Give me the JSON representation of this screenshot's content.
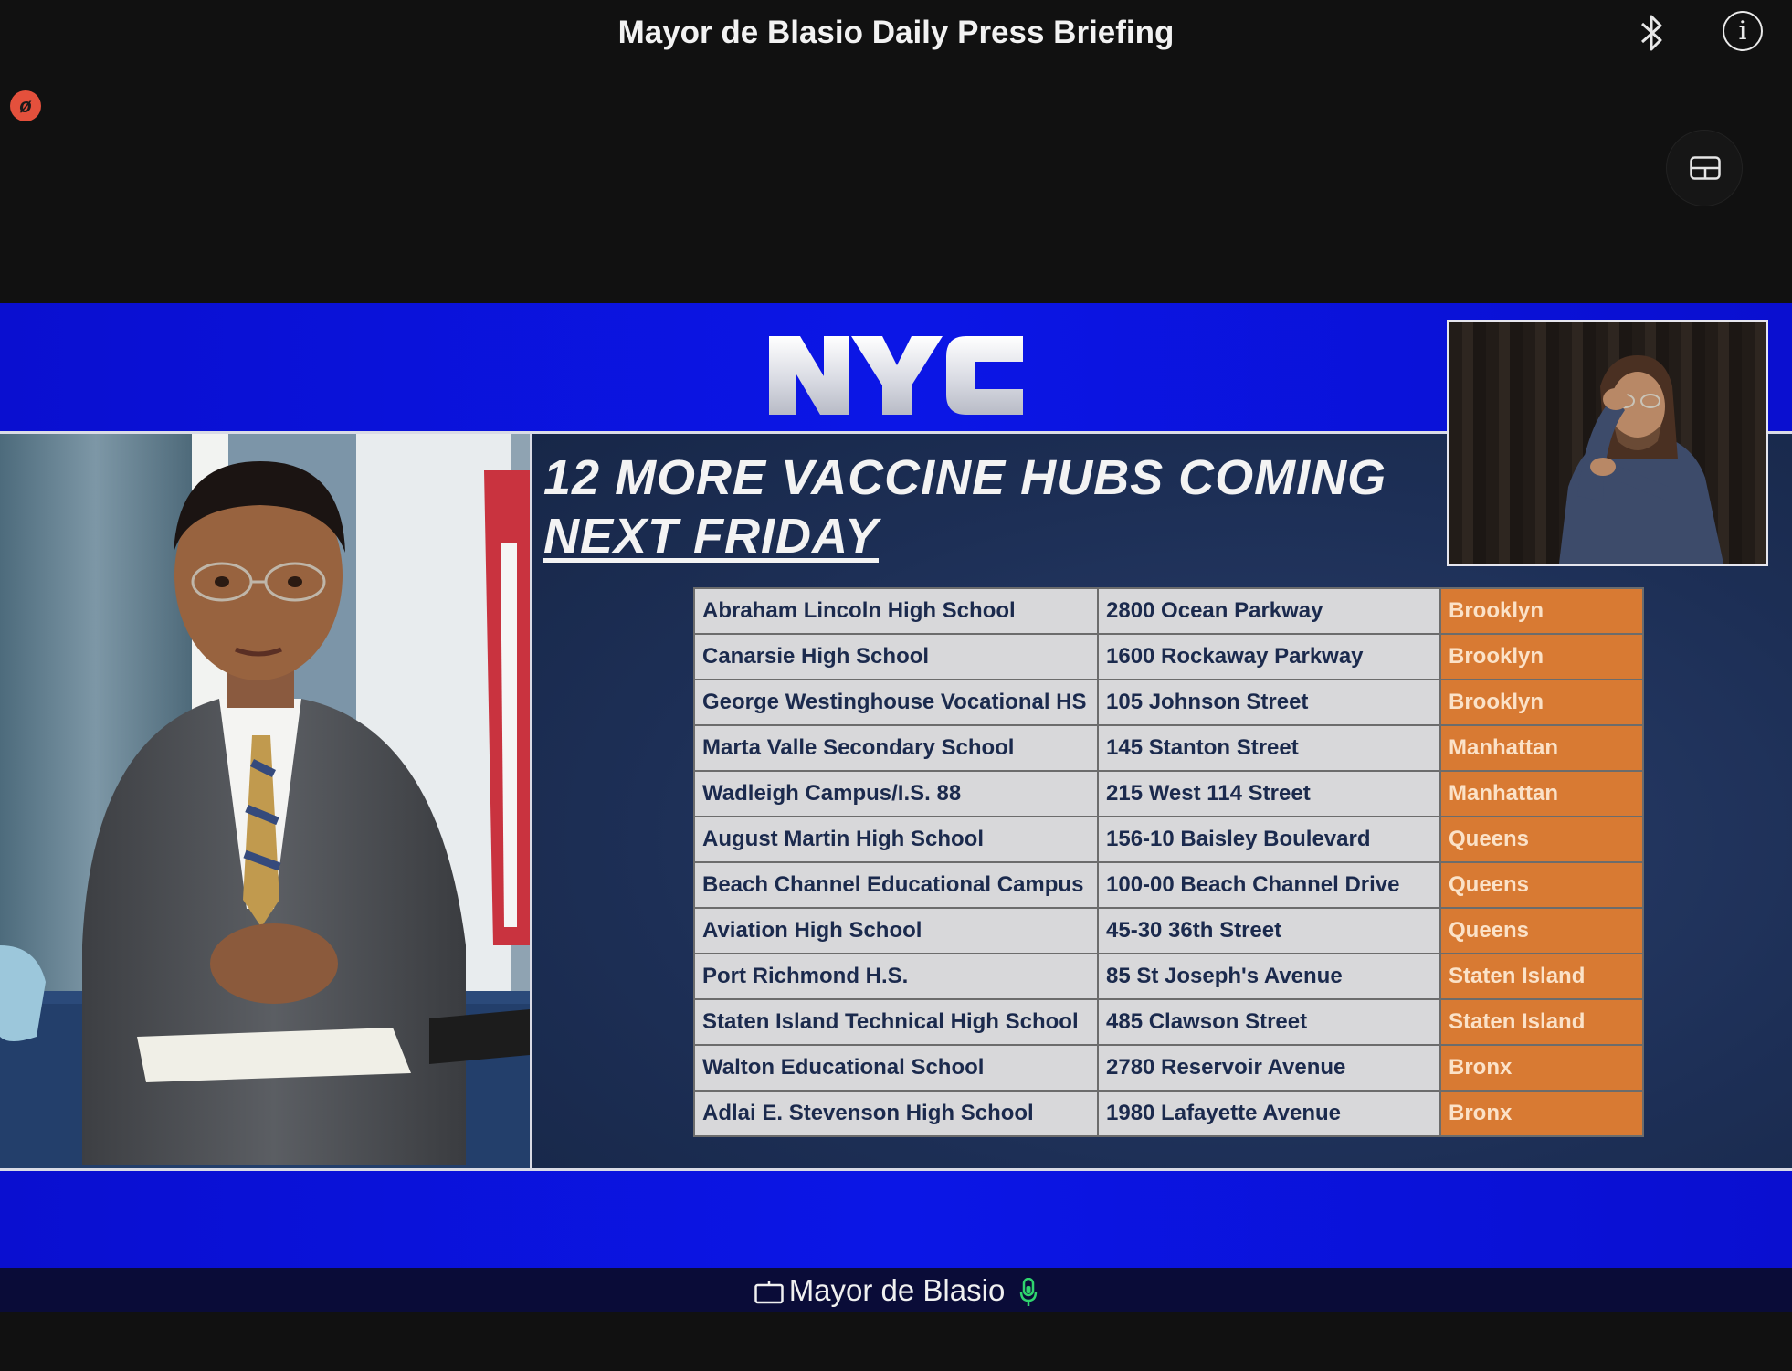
{
  "window": {
    "title": "Mayor de Blasio Daily Press Briefing"
  },
  "icons": {
    "bluetooth": "bluetooth-icon",
    "info": "info-icon",
    "info_glyph": "i",
    "recording": "recording-indicator-icon",
    "recording_glyph": "ø",
    "layout": "layout-toggle-icon"
  },
  "broadcast": {
    "logo_text": "NYC",
    "slide": {
      "title_line1": "12 MORE VACCINE HUBS COMING",
      "title_line2": "NEXT FRIDAY",
      "hubs": [
        {
          "name": "Abraham Lincoln High School",
          "address": "2800 Ocean Parkway",
          "borough": "Brooklyn"
        },
        {
          "name": "Canarsie High School",
          "address": "1600 Rockaway Parkway",
          "borough": "Brooklyn"
        },
        {
          "name": "George Westinghouse Vocational HS",
          "address": "105 Johnson Street",
          "borough": "Brooklyn"
        },
        {
          "name": "Marta Valle Secondary School",
          "address": "145 Stanton Street",
          "borough": "Manhattan"
        },
        {
          "name": "Wadleigh Campus/I.S. 88",
          "address": "215 West 114 Street",
          "borough": "Manhattan"
        },
        {
          "name": "August Martin High School",
          "address": "156-10 Baisley Boulevard",
          "borough": "Queens"
        },
        {
          "name": "Beach Channel Educational Campus",
          "address": "100-00 Beach Channel Drive",
          "borough": "Queens"
        },
        {
          "name": "Aviation High School",
          "address": "45-30 36th Street",
          "borough": "Queens"
        },
        {
          "name": "Port Richmond H.S.",
          "address": "85 St Joseph's Avenue",
          "borough": "Staten Island"
        },
        {
          "name": "Staten Island Technical High School",
          "address": "485 Clawson Street",
          "borough": "Staten Island"
        },
        {
          "name": "Walton Educational School",
          "address": "2780 Reservoir Avenue",
          "borough": "Bronx"
        },
        {
          "name": "Adlai E. Stevenson High School",
          "address": "1980 Lafayette Avenue",
          "borough": "Bronx"
        }
      ]
    }
  },
  "active_speaker": {
    "name": "Mayor de Blasio"
  },
  "colors": {
    "broadcast_blue": "#0b16e6",
    "slide_navy": "#1d2f56",
    "table_cell": "#d8d8da",
    "borough_orange": "#d87a33",
    "mic_green": "#2fd46e",
    "recording_red": "#e4503c"
  }
}
